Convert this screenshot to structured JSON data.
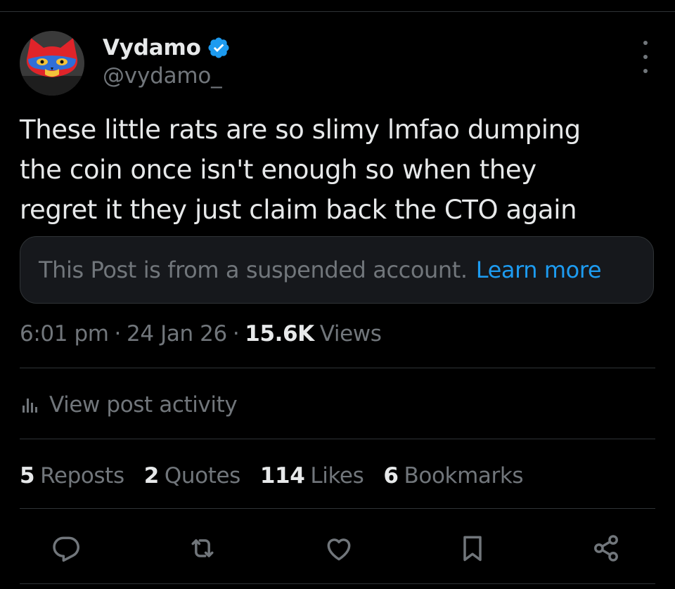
{
  "author": {
    "display_name": "Vydamo",
    "handle": "@vydamo_",
    "verified": true,
    "verified_icon": "verified-badge-icon",
    "avatar": "cartoon-cat-avatar"
  },
  "post": {
    "text": "These little rats are so slimy lmfao dumping\nthe coin once isn't enough so when they\nregret it they just claim back the CTO again"
  },
  "notice": {
    "text": "This Post is from a suspended account.",
    "link": "Learn more"
  },
  "meta": {
    "time": "6:01 pm",
    "separator": "·",
    "date": "24 Jan 26",
    "views_count": "15.6K",
    "views_label": "Views"
  },
  "activity": {
    "label": "View post activity",
    "icon": "bar-chart-icon"
  },
  "stats": [
    {
      "count": "5",
      "label": "Reposts"
    },
    {
      "count": "2",
      "label": "Quotes"
    },
    {
      "count": "114",
      "label": "Likes"
    },
    {
      "count": "6",
      "label": "Bookmarks"
    }
  ],
  "actions": [
    "reply-icon",
    "repost-icon",
    "like-icon",
    "bookmark-icon",
    "share-icon"
  ],
  "colors": {
    "background": "#000000",
    "text_primary": "#e7e9ea",
    "text_secondary": "#71767b",
    "accent": "#1d9bf0",
    "divider": "#2f3336",
    "notice_bg": "#16181c"
  }
}
